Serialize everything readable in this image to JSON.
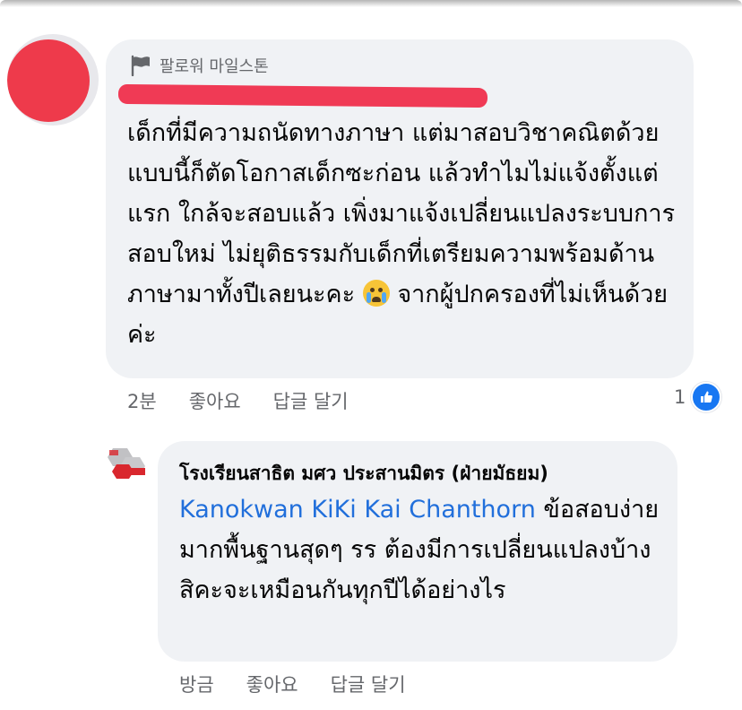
{
  "comment": {
    "badge": "팔로워 마일스톤",
    "text_before_emoji": "เด็กที่มีความถนัดทางภาษา แต่มาสอบวิชาคณิตด้วย แบบนี้ก็ตัดโอกาสเด็กซะก่อน แล้วทำไมไม่แจ้งตั้งแต่แรก ใกล้จะสอบแล้ว เพิ่งมาแจ้งเปลี่ยนแปลงระบบการสอบใหม่ ไม่ยุติธรรมกับเด็กที่เตรียมความพร้อมด้านภาษามาทั้งปีเลยนะคะ",
    "emoji": "loudly-crying-face-emoji",
    "text_after_emoji": "จากผู้ปกครองที่ไม่เห็นด้วยค่ะ",
    "time": "2분",
    "like_label": "좋아요",
    "reply_label": "답글 달기",
    "reaction_count": "1"
  },
  "reply": {
    "author": "โรงเรียนสาธิต มศว ประสานมิตร (ฝ่ายมัธยม)",
    "mention": "Kanokwan KiKi Kai Chanthorn",
    "text": "ข้อสอบง่ายมากพื้นฐานสุดๆ  รร ต้องมีการเปลี่ยนแปลงบ้างสิคะจะเหมือนกันทุกปีได้อย่างไร",
    "time": "방금",
    "like_label": "좋아요",
    "reply_label": "답글 달기"
  },
  "colors": {
    "bubble": "#f0f2f5",
    "mention": "#216fdb",
    "like_blue": "#1877f2",
    "redaction": "#ee3a4b",
    "meta_text": "#65676b"
  },
  "icons": {
    "badge": "flag-icon",
    "reaction": "thumbs-up-icon",
    "school_logo": "school-logo"
  }
}
